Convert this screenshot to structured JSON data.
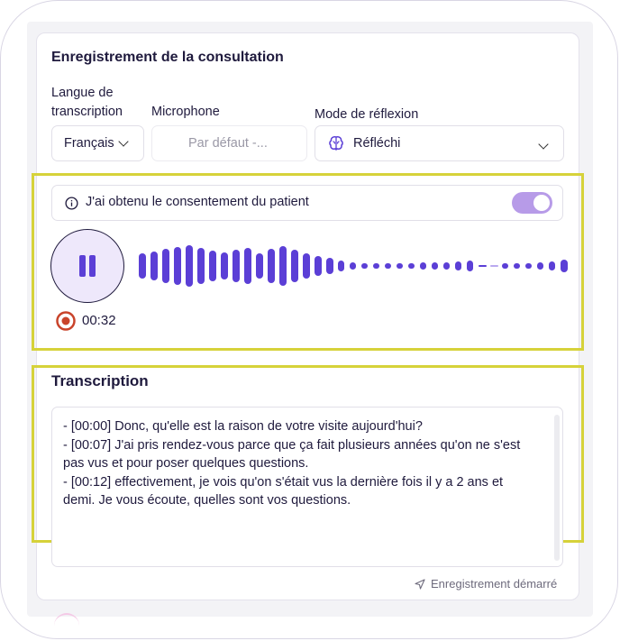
{
  "section_title": "Enregistrement de la consultation",
  "fields": {
    "language": {
      "label": "Langue de transcription",
      "value": "Français"
    },
    "microphone": {
      "label": "Microphone",
      "value": "Par défaut -..."
    },
    "reflection": {
      "label": "Mode de réflexion",
      "value": "Réfléchi",
      "icon": "brain-icon"
    }
  },
  "consent": {
    "text": "J'ai obtenu le consentement du patient",
    "enabled": true,
    "icon": "info-icon"
  },
  "recorder": {
    "timer": "00:32",
    "state": "recording",
    "pause_icon": "pause-icon",
    "record_icon": "record-icon"
  },
  "transcription": {
    "title": "Transcription",
    "lines": [
      "- [00:00] Donc, qu'elle est la raison de votre visite aujourd'hui?",
      "- [00:07] J'ai pris rendez-vous parce que ça fait plusieurs années qu'on ne s'est pas vus et pour poser quelques questions.",
      "- [00:12] effectivement, je vois qu'on s'était vus la dernière fois il y a 2 ans et demi. Je vous écoute, quelles sont vos questions."
    ]
  },
  "status": {
    "text": "Enregistrement démarré",
    "icon": "send-icon"
  },
  "colors": {
    "accent": "#5b3fd6",
    "toggle": "#b79be8",
    "highlight": "#d6d23a",
    "record": "#c9442b"
  }
}
